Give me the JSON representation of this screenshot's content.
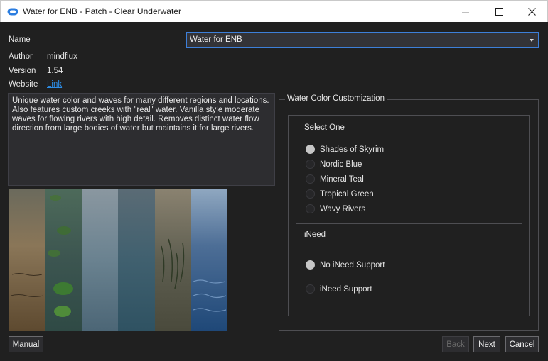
{
  "window": {
    "title": "Water for ENB - Patch - Clear Underwater"
  },
  "info": {
    "name_label": "Name",
    "name_value": "Water for ENB",
    "author_label": "Author",
    "author_value": "mindflux",
    "version_label": "Version",
    "version_value": "1.54",
    "website_label": "Website",
    "website_link": "Link"
  },
  "description": "Unique water color and waves for many different regions and locations. Also features custom creeks with \"real\" water. Vanilla style moderate waves for flowing rivers with high detail. Removes distinct water flow direction from large bodies of water but maintains it for large rivers.",
  "customization": {
    "title": "Water Color Customization",
    "select_one": {
      "title": "Select One",
      "options": [
        {
          "label": "Shades of Skyrim",
          "checked": true
        },
        {
          "label": "Nordic Blue",
          "checked": false
        },
        {
          "label": "Mineral Teal",
          "checked": false
        },
        {
          "label": "Tropical Green",
          "checked": false
        },
        {
          "label": "Wavy Rivers",
          "checked": false
        }
      ]
    },
    "ineed": {
      "title": "iNeed",
      "options": [
        {
          "label": "No iNeed Support",
          "checked": true
        },
        {
          "label": "iNeed Support",
          "checked": false
        }
      ]
    }
  },
  "buttons": {
    "manual": "Manual",
    "back": "Back",
    "next": "Next",
    "cancel": "Cancel"
  },
  "colors": {
    "accent": "#3d7fd8",
    "link": "#2d8ee8",
    "background": "#202020"
  }
}
